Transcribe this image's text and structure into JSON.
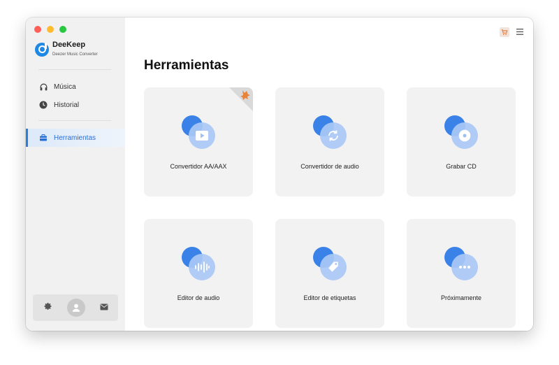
{
  "app": {
    "name": "DeeKeep",
    "subtitle": "Deezer Music Converter"
  },
  "sidebar": {
    "items": [
      {
        "label": "Música",
        "icon": "headphones-icon"
      },
      {
        "label": "Historial",
        "icon": "clock-icon"
      },
      {
        "label": "Herramientas",
        "icon": "toolbox-icon",
        "active": true
      }
    ],
    "bottom": [
      {
        "icon": "gear-icon"
      },
      {
        "icon": "user-avatar-icon"
      },
      {
        "icon": "mail-icon"
      }
    ]
  },
  "header": {
    "icons": [
      "cart-icon",
      "menu-icon"
    ]
  },
  "main": {
    "title": "Herramientas",
    "tools": [
      {
        "label": "Convertidor AA/AAX",
        "icon": "video-icon",
        "badge": "premium-badge-icon"
      },
      {
        "label": "Convertidor de audio",
        "icon": "convert-refresh-icon"
      },
      {
        "label": "Grabar CD",
        "icon": "disc-icon"
      },
      {
        "label": "Editor de audio",
        "icon": "waveform-icon"
      },
      {
        "label": "Editor de etiquetas",
        "icon": "tag-icon"
      },
      {
        "label": "Próximamente",
        "icon": "more-dots-icon"
      }
    ]
  },
  "colors": {
    "accent": "#2a7de1",
    "sidebar_bg": "#f1f1f1",
    "card_bg": "#f2f2f2",
    "icon_blue": "#3b82e8"
  }
}
